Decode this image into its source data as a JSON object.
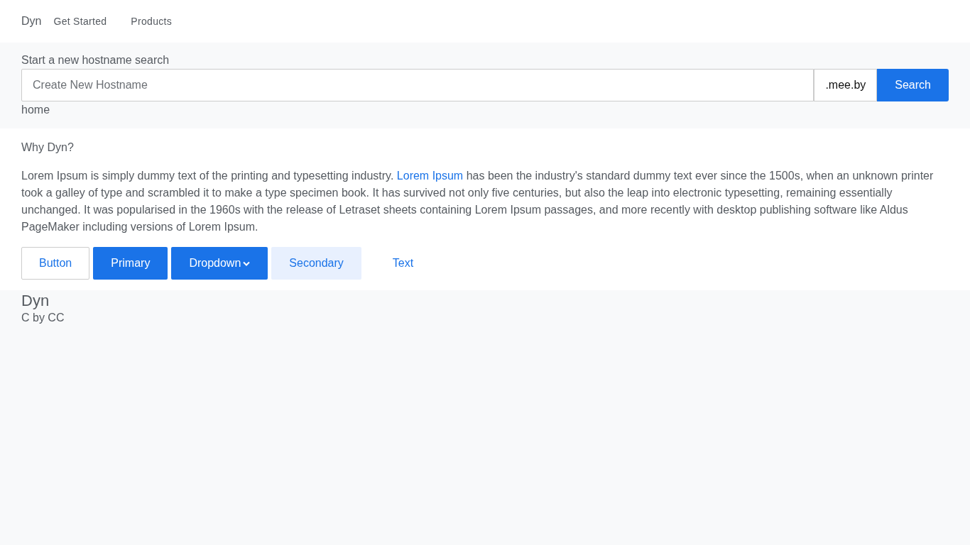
{
  "navbar": {
    "brand": "Dyn",
    "links": [
      "Get Started",
      "Products"
    ]
  },
  "search": {
    "label": "Start a new hostname search",
    "placeholder": "Create New Hostname",
    "suffix": ".mee.by",
    "button": "Search",
    "note": "home"
  },
  "why": {
    "heading": "Why Dyn?",
    "paragraph": {
      "before": "Lorem Ipsum is simply dummy text of the printing and typesetting industry. ",
      "link": "Lorem Ipsum",
      "after": " has been the industry's standard dummy text ever since the 1500s, when an unknown printer took a galley of type and scrambled it to make a type specimen book. It has survived not only five centuries, but also the leap into electronic typesetting, remaining essentially unchanged. It was popularised in the 1960s with the release of Letraset sheets containing Lorem Ipsum passages, and more recently with desktop publishing software like Aldus PageMaker including versions of Lorem Ipsum."
    },
    "buttons": [
      {
        "label": "Button",
        "kind": "outline"
      },
      {
        "label": "Primary",
        "kind": "primary"
      },
      {
        "label": "Dropdown",
        "kind": "dropdown"
      },
      {
        "label": "Secondary",
        "kind": "secondary"
      },
      {
        "label": "Text",
        "kind": "text"
      }
    ]
  },
  "footer": {
    "title": "Dyn",
    "credit": "C by CC"
  }
}
